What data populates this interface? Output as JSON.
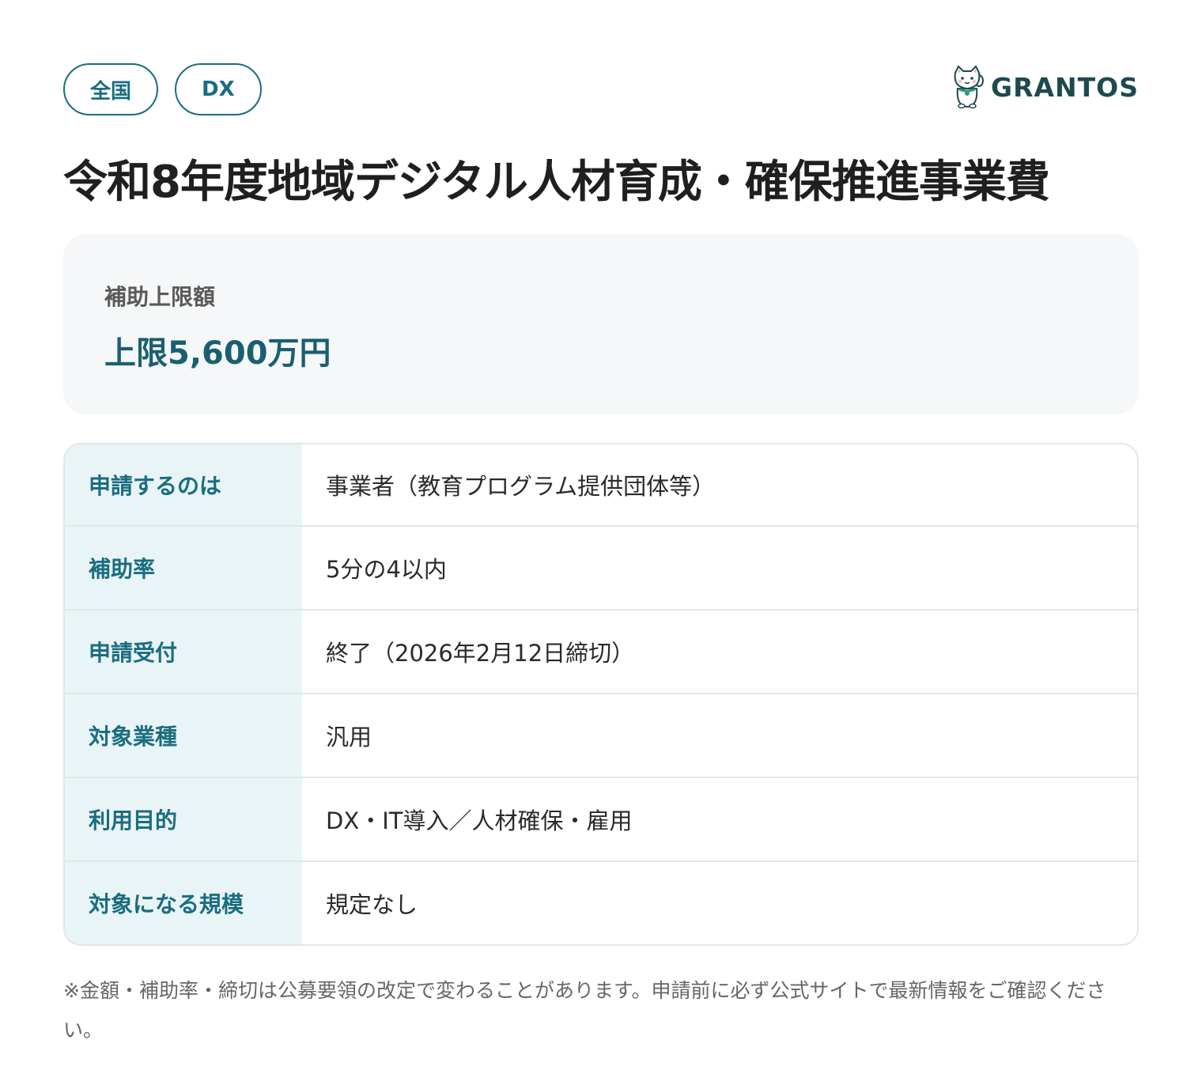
{
  "tags": [
    "全国",
    "DX"
  ],
  "brand": {
    "name": "GRANTOS",
    "logo_icon": "lucky-cat-icon"
  },
  "title": "令和8年度地域デジタル人材育成・確保推進事業費",
  "amount": {
    "label": "補助上限額",
    "value": "上限5,600万円"
  },
  "info": [
    {
      "key": "申請するのは",
      "value": "事業者（教育プログラム提供団体等）"
    },
    {
      "key": "補助率",
      "value": "5分の4以内"
    },
    {
      "key": "申請受付",
      "value": "終了（2026年2月12日締切）"
    },
    {
      "key": "対象業種",
      "value": "汎用"
    },
    {
      "key": "利用目的",
      "value": "DX・IT導入／人材確保・雇用"
    },
    {
      "key": "対象になる規模",
      "value": "規定なし"
    }
  ],
  "note": "※金額・補助率・締切は公募要領の改定で変わることがあります。申請前に必ず公式サイトで最新情報をご確認ください。",
  "colors": {
    "accent": "#1a6d80",
    "brand": "#1e4a4e",
    "key_bg": "#e9f4f6",
    "card_bg": "#f5f7f8"
  }
}
